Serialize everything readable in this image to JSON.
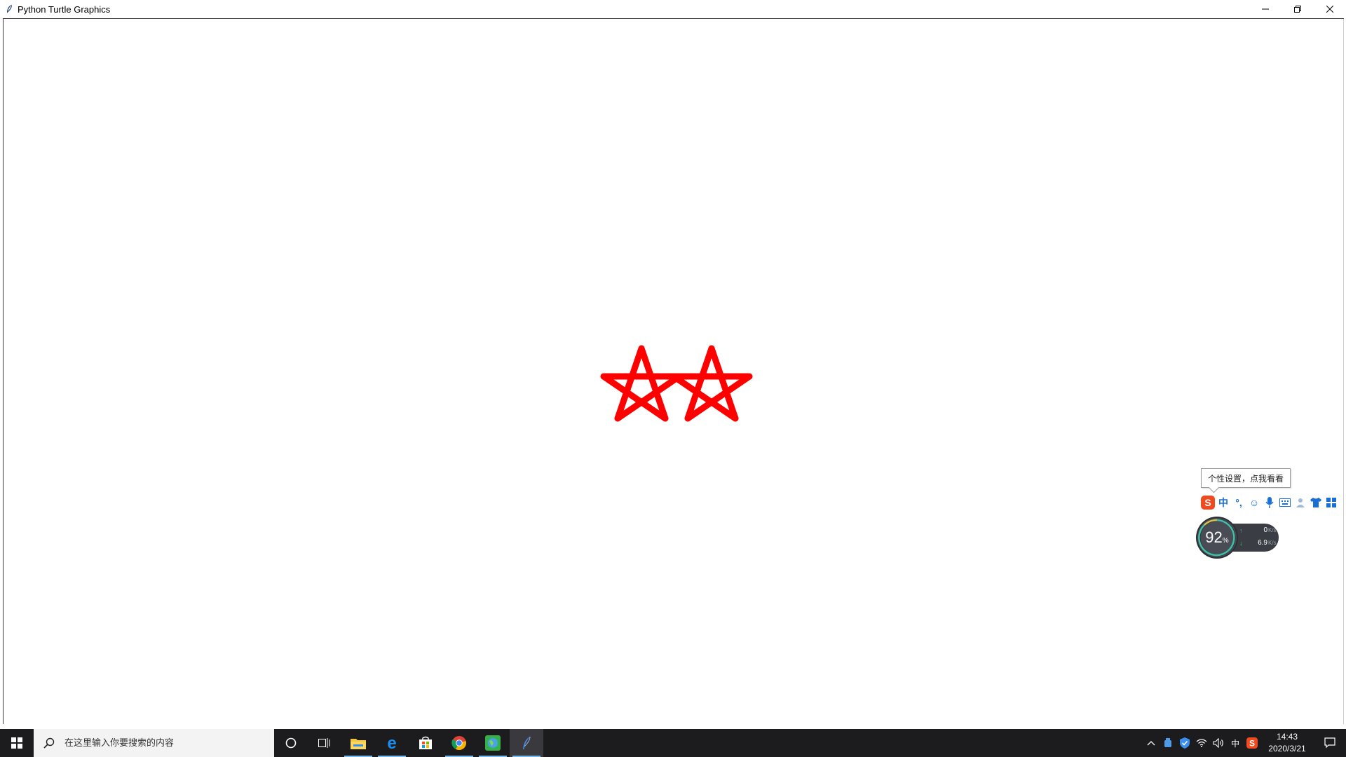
{
  "window": {
    "title": "Python Turtle Graphics",
    "controls": [
      "minimize",
      "restore",
      "close"
    ]
  },
  "canvas": {
    "background": "#ffffff",
    "drawing": {
      "shape": "star",
      "count": 2,
      "stroke_color": "#ff0000",
      "fill": "none"
    }
  },
  "ime": {
    "tooltip": "个性设置，点我看看",
    "toolbar_items": [
      {
        "icon": "sogou-logo-icon",
        "label": "S"
      },
      {
        "icon": "chinese-mode-icon",
        "label": "中"
      },
      {
        "icon": "punctuation-icon",
        "label": "°,"
      },
      {
        "icon": "emoji-icon",
        "label": "☺"
      },
      {
        "icon": "microphone-icon",
        "label": "🎤"
      },
      {
        "icon": "keyboard-icon",
        "label": "⌨"
      },
      {
        "icon": "user-icon",
        "label": "👤"
      },
      {
        "icon": "skin-shirt-icon",
        "label": "👕"
      },
      {
        "icon": "toolbox-grid-icon",
        "label": "▦"
      }
    ]
  },
  "net_widget": {
    "percent": "92",
    "percent_unit": "%",
    "upload": "0",
    "download": "6.9",
    "unit": "K/s"
  },
  "taskbar": {
    "search_placeholder": "在这里输入你要搜索的内容",
    "apps": [
      {
        "icon": "cortana-icon"
      },
      {
        "icon": "task-view-icon"
      },
      {
        "icon": "file-explorer-icon",
        "underline": true
      },
      {
        "icon": "edge-icon",
        "underline": true
      },
      {
        "icon": "store-icon"
      },
      {
        "icon": "chrome-icon",
        "underline": true
      },
      {
        "icon": "maps-globe-icon",
        "underline": true
      },
      {
        "icon": "python-feather-icon",
        "underline": true,
        "active": true
      }
    ],
    "tray": {
      "ime_label": "中",
      "time": "14:43",
      "date": "2020/3/21"
    }
  }
}
